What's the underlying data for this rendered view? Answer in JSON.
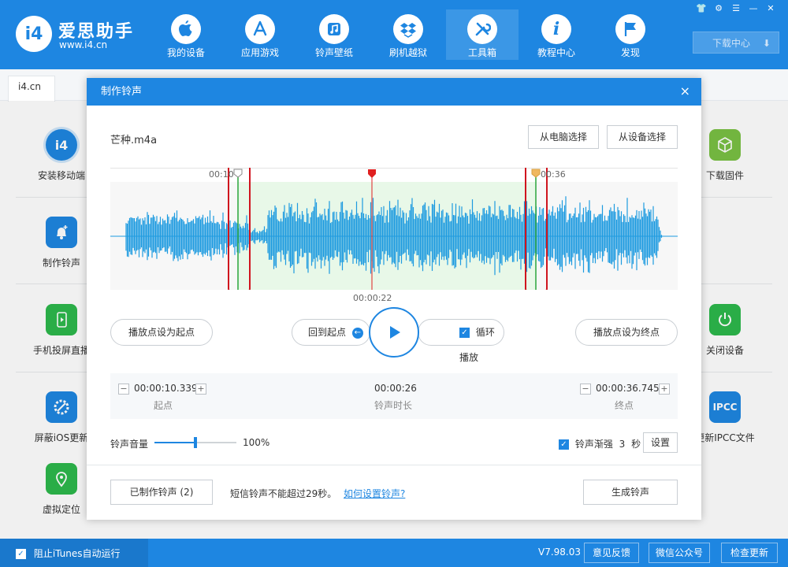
{
  "app": {
    "title": "爱思助手",
    "url": "www.i4.cn",
    "logo_text": "i4"
  },
  "nav": [
    {
      "label": "我的设备",
      "icon": "apple-icon"
    },
    {
      "label": "应用游戏",
      "icon": "app-store-icon"
    },
    {
      "label": "铃声壁纸",
      "icon": "music-icon"
    },
    {
      "label": "刷机越狱",
      "icon": "dropbox-icon"
    },
    {
      "label": "工具箱",
      "icon": "toolbox-icon",
      "active": true
    },
    {
      "label": "教程中心",
      "icon": "info-icon"
    },
    {
      "label": "发现",
      "icon": "flag-icon"
    }
  ],
  "header": {
    "download_label": "下载中心"
  },
  "tab": {
    "label": "i4.cn"
  },
  "tools_left": [
    {
      "label": "安装移动端",
      "icon": "i4-app-icon",
      "color": "#1e86e1"
    },
    {
      "label": "制作铃声",
      "icon": "bell-icon",
      "color": "#1e86e1"
    },
    {
      "label": "手机投屏直播",
      "icon": "screen-mirror-icon",
      "color": "#2db84c"
    },
    {
      "label": "屏蔽iOS更新",
      "icon": "block-update-icon",
      "color": "#1e86e1"
    },
    {
      "label": "虚拟定位",
      "icon": "location-icon",
      "color": "#2db84c"
    }
  ],
  "tools_right": [
    {
      "label": "下载固件",
      "icon": "firmware-cube-icon",
      "color": "#7ac143"
    },
    {
      "label": "关闭设备",
      "icon": "power-icon",
      "color": "#2db84c"
    },
    {
      "label": "更新IPCC文件",
      "icon": "ipcc-icon",
      "icon_text": "IPCC",
      "color": "#1e86e1"
    }
  ],
  "dialog": {
    "title": "制作铃声",
    "close": "×",
    "filename": "芒种.m4a",
    "btn_from_pc": "从电脑选择",
    "btn_from_device": "从设备选择",
    "marker_start_label": "00:10",
    "marker_end_label": "00:36",
    "playhead_label": "00:00:22",
    "btn_set_start": "播放点设为起点",
    "btn_back_to_start": "回到起点",
    "loop_label": "循环播放",
    "btn_set_end": "播放点设为终点",
    "start_time": "00:00:10.339",
    "start_caption": "起点",
    "duration": "00:00:26",
    "duration_caption": "铃声时长",
    "end_time": "00:00:36.745",
    "end_caption": "终点",
    "minus": "−",
    "plus": "+",
    "volume_label": "铃声音量",
    "volume_value": "100%",
    "volume_level": 0.5,
    "fade_label": "铃声渐强",
    "fade_value": "3",
    "fade_unit": "秒",
    "btn_settings": "设置",
    "btn_made": "已制作铃声 (2)",
    "sms_note": "短信铃声不能超过29秒。",
    "howto_link": "如何设置铃声?",
    "btn_generate": "生成铃声"
  },
  "footer": {
    "itunes_label": "阻止iTunes自动运行",
    "version": "V7.98.03",
    "feedback": "意见反馈",
    "wechat": "微信公众号",
    "check_update": "检查更新"
  },
  "colors": {
    "brand": "#1e86e1",
    "waveform": "#1e9be0",
    "selection": "#e8f8e8",
    "playhead": "#e02020",
    "annotation": "#d0141e"
  }
}
